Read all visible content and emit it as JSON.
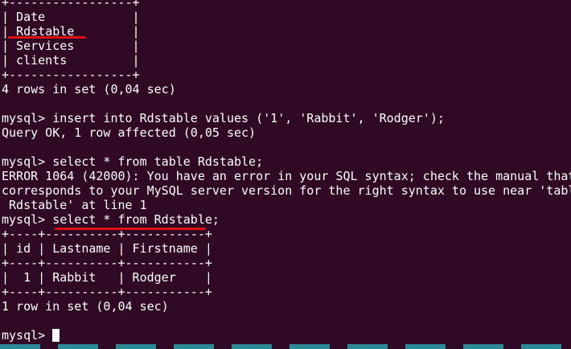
{
  "terminal": {
    "lines": [
      "+-----------------+",
      "| Date            |",
      "| Rdstable        |",
      "| Services        |",
      "| clients         |",
      "+-----------------+",
      "4 rows in set (0,04 sec)",
      "",
      "mysql> insert into Rdstable values ('1', 'Rabbit', 'Rodger');",
      "Query OK, 1 row affected (0,05 sec)",
      "",
      "mysql> select * from table Rdstable;",
      "ERROR 1064 (42000): You have an error in your SQL syntax; check the manual that",
      "corresponds to your MySQL server version for the right syntax to use near 'tabl",
      " Rdstable' at line 1",
      "mysql> select * from Rdstable;",
      "+----+----------+-----------+",
      "| id | Lastname | Firstname |",
      "+----+----------+-----------+",
      "|  1 | Rabbit   | Rodger    |",
      "+----+----------+-----------+",
      "1 row in set (0,04 sec)",
      ""
    ],
    "prompt": "mysql> "
  },
  "colors": {
    "background": "#300a24",
    "text": "#ffffff",
    "annotation": "#e01010"
  }
}
